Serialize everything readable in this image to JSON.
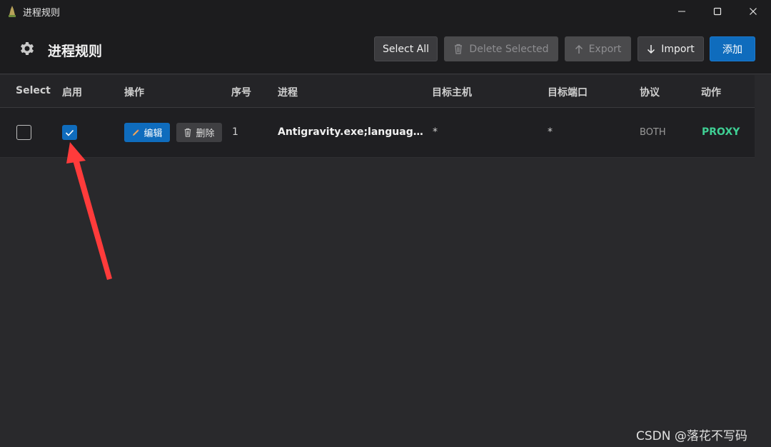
{
  "window": {
    "title": "进程规则",
    "controls": [
      "minimize-icon",
      "maximize-icon",
      "close-icon"
    ]
  },
  "header": {
    "title": "进程规则",
    "icon": "gear-icon",
    "buttons": {
      "select_all": "Select All",
      "delete_selected": "Delete Selected",
      "export": "Export",
      "import": "Import",
      "add": "添加"
    }
  },
  "table": {
    "columns": [
      "Select",
      "启用",
      "操作",
      "序号",
      "进程",
      "目标主机",
      "目标端口",
      "协议",
      "动作"
    ],
    "rows": [
      {
        "selected": false,
        "enabled": true,
        "edit_label": "编辑",
        "delete_label": "删除",
        "seq": "1",
        "process": "Antigravity.exe;language_...",
        "target_host": "*",
        "target_port": "*",
        "protocol": "BOTH",
        "action": "PROXY"
      }
    ]
  },
  "watermark": "CSDN @落花不写码",
  "colors": {
    "accent": "#0f6cbd",
    "action_proxy": "#3fcf94",
    "annotation_arrow": "#ff3b3b"
  }
}
